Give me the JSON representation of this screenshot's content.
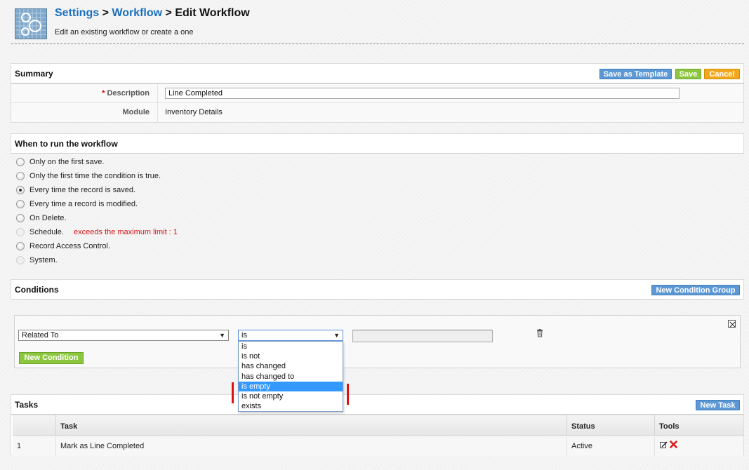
{
  "header": {
    "breadcrumb": {
      "settings": "Settings",
      "sep1": ">",
      "workflow": "Workflow",
      "sep2": ">",
      "current": "Edit Workflow"
    },
    "subtitle": "Edit an existing workflow or create a one",
    "logo_icon": "workflow-settings-icon"
  },
  "summary": {
    "title": "Summary",
    "buttons": {
      "save_as_template": "Save as Template",
      "save": "Save",
      "cancel": "Cancel"
    },
    "description_label": "Description",
    "required_mark": "*",
    "description_value": "Line Completed",
    "module_label": "Module",
    "module_value": "Inventory Details"
  },
  "when_to_run": {
    "title": "When to run the workflow",
    "options": [
      {
        "label": "Only on the first save.",
        "checked": false,
        "disabled": false
      },
      {
        "label": "Only the first time the condition is true.",
        "checked": false,
        "disabled": false
      },
      {
        "label": "Every time the record is saved.",
        "checked": true,
        "disabled": false
      },
      {
        "label": "Every time a record is modified.",
        "checked": false,
        "disabled": false
      },
      {
        "label": "On Delete.",
        "checked": false,
        "disabled": false
      },
      {
        "label": "Schedule.",
        "checked": false,
        "disabled": true
      },
      {
        "label": "Record Access Control.",
        "checked": false,
        "disabled": false
      },
      {
        "label": "System.",
        "checked": false,
        "disabled": true
      }
    ],
    "schedule_warning": "exceeds the maximum limit : 1"
  },
  "conditions": {
    "title": "Conditions",
    "new_group_button": "New Condition Group",
    "field_select": "Related To",
    "operator_select": "is",
    "value": "",
    "new_condition_button": "New Condition",
    "operator_options": [
      "is",
      "is not",
      "has changed",
      "has changed to",
      "is empty",
      "is not empty",
      "exists"
    ],
    "highlighted_option": "is empty"
  },
  "tasks": {
    "title": "Tasks",
    "new_task_button": "New Task",
    "columns": [
      "",
      "Task",
      "Status",
      "Tools"
    ],
    "rows": [
      {
        "num": "1",
        "task": "Mark as Line Completed",
        "status": "Active"
      }
    ]
  },
  "colors": {
    "link": "#1a6fbf",
    "blue_button": "#5c98d4",
    "green_button": "#8cc63f",
    "orange_button": "#f2a81d",
    "warning": "#d41616",
    "highlight": "#3399ff"
  }
}
